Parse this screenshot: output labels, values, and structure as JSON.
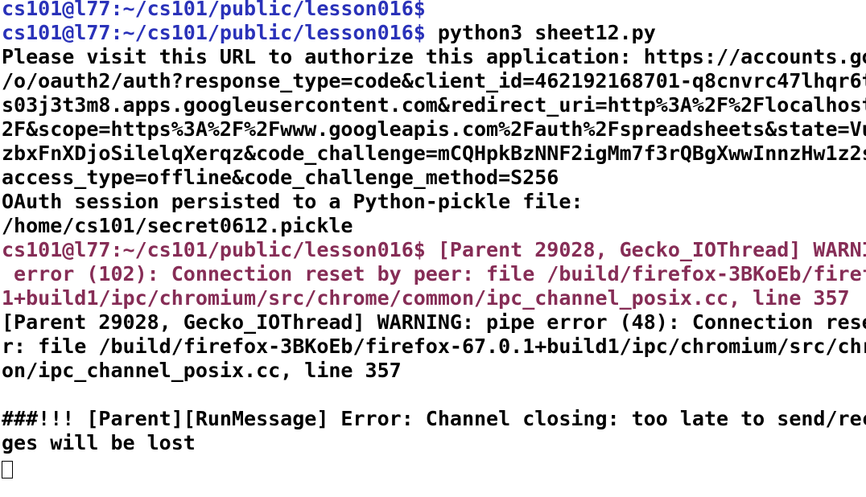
{
  "colors": {
    "prompt": "#2a32b9",
    "error": "#862d56",
    "text": "#000000",
    "background": "#ffffff"
  },
  "lines": [
    {
      "segments": [
        {
          "text": "cs101@l77:~/cs101/public/lesson016$",
          "color": "#2a32b9"
        }
      ]
    },
    {
      "segments": [
        {
          "text": "cs101@l77:~/cs101/public/lesson016$",
          "color": "#2a32b9"
        },
        {
          "text": " python3 sheet12.py",
          "color": "#000000"
        }
      ]
    },
    {
      "segments": [
        {
          "text": "Please visit this URL to authorize this application: https://accounts.go",
          "color": "#000000"
        }
      ]
    },
    {
      "segments": [
        {
          "text": "/o/oauth2/auth?response_type=code&client_id=462192168701-q8cnvrc47lhqr6t",
          "color": "#000000"
        }
      ]
    },
    {
      "segments": [
        {
          "text": "s03j3t3m8.apps.googleusercontent.com&redirect_uri=http%3A%2F%2Flocalhost",
          "color": "#000000"
        }
      ]
    },
    {
      "segments": [
        {
          "text": "2F&scope=https%3A%2F%2Fwww.googleapis.com%2Fauth%2Fspreadsheets&state=Vu",
          "color": "#000000"
        }
      ]
    },
    {
      "segments": [
        {
          "text": "zbxFnXDjoSilelqXerqz&code_challenge=mCQHpkBzNNF2igMm7f3rQBgXwwInnzHw1z2s",
          "color": "#000000"
        }
      ]
    },
    {
      "segments": [
        {
          "text": "access_type=offline&code_challenge_method=S256",
          "color": "#000000"
        }
      ]
    },
    {
      "segments": [
        {
          "text": "OAuth session persisted to a Python-pickle file:",
          "color": "#000000"
        }
      ]
    },
    {
      "segments": [
        {
          "text": "/home/cs101/secret0612.pickle",
          "color": "#000000"
        }
      ]
    },
    {
      "segments": [
        {
          "text": "cs101@l77:~/cs101/public/lesson016$ [Parent 29028, Gecko_IOThread] WARNI",
          "color": "#862d56"
        }
      ]
    },
    {
      "segments": [
        {
          "text": " error (102): Connection reset by peer: file /build/firefox-3BKoEb/firef",
          "color": "#862d56"
        }
      ]
    },
    {
      "segments": [
        {
          "text": "1+build1/ipc/chromium/src/chrome/common/ipc_channel_posix.cc, line 357",
          "color": "#862d56"
        }
      ]
    },
    {
      "segments": [
        {
          "text": "[Parent 29028, Gecko_IOThread] WARNING: pipe error (48): Connection rese",
          "color": "#000000"
        }
      ]
    },
    {
      "segments": [
        {
          "text": "r: file /build/firefox-3BKoEb/firefox-67.0.1+build1/ipc/chromium/src/chr",
          "color": "#000000"
        }
      ]
    },
    {
      "segments": [
        {
          "text": "on/ipc_channel_posix.cc, line 357",
          "color": "#000000"
        }
      ]
    },
    {
      "segments": [
        {
          "text": "",
          "color": "#000000"
        }
      ]
    },
    {
      "segments": [
        {
          "text": "###!!! [Parent][RunMessage] Error: Channel closing: too late to send/rec",
          "color": "#000000"
        }
      ]
    },
    {
      "segments": [
        {
          "text": "ges will be lost",
          "color": "#000000"
        }
      ]
    },
    {
      "segments": [
        {
          "text": "",
          "color": "#000000"
        }
      ]
    }
  ]
}
